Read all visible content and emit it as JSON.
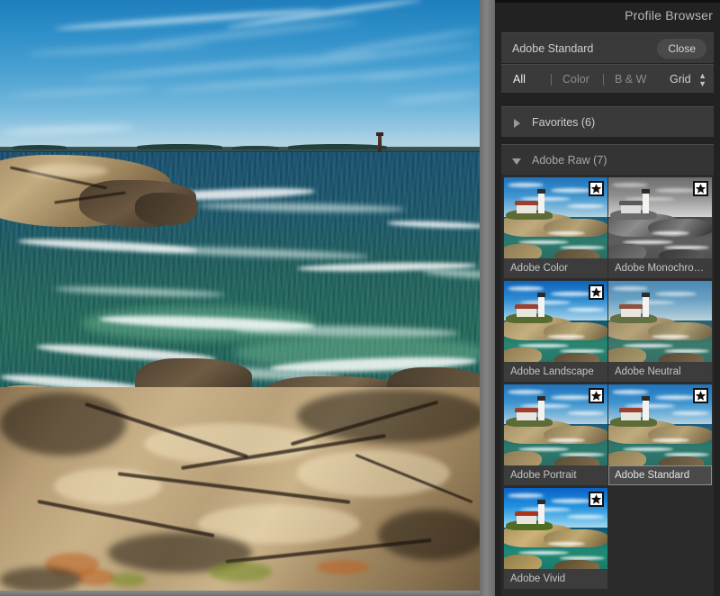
{
  "panel": {
    "title": "Profile Browser",
    "current_profile": "Adobe Standard",
    "close_label": "Close",
    "filters": [
      {
        "label": "All",
        "active": true
      },
      {
        "label": "Color",
        "active": false
      },
      {
        "label": "B & W",
        "active": false
      }
    ],
    "view_mode": "Grid",
    "groups": [
      {
        "name": "Favorites (6)",
        "expanded": false
      },
      {
        "name": "Adobe Raw (7)",
        "expanded": true
      }
    ],
    "profiles": [
      {
        "label": "Adobe Color",
        "favorite": true,
        "selected": false,
        "style": "color"
      },
      {
        "label": "Adobe Monochro…",
        "favorite": true,
        "selected": false,
        "style": "mono"
      },
      {
        "label": "Adobe Landscape",
        "favorite": true,
        "selected": false,
        "style": "landscape"
      },
      {
        "label": "Adobe Neutral",
        "favorite": false,
        "selected": false,
        "style": "neutral"
      },
      {
        "label": "Adobe Portrait",
        "favorite": true,
        "selected": false,
        "style": "color"
      },
      {
        "label": "Adobe Standard",
        "favorite": true,
        "selected": true,
        "style": "color"
      },
      {
        "label": "Adobe Vivid",
        "favorite": true,
        "selected": false,
        "style": "vivid"
      }
    ]
  },
  "viewer": {
    "photo_description": "Rocky coastal seascape with blue sky, distant islands and breaking surf"
  },
  "colors": {
    "panel_bg": "#222222",
    "block_bg": "#3a3a3a",
    "grid_bg": "#2b2b2b",
    "text_primary": "#cfcfcf",
    "text_dim": "#8d8d8d",
    "gutter": "#7d7d7d"
  }
}
